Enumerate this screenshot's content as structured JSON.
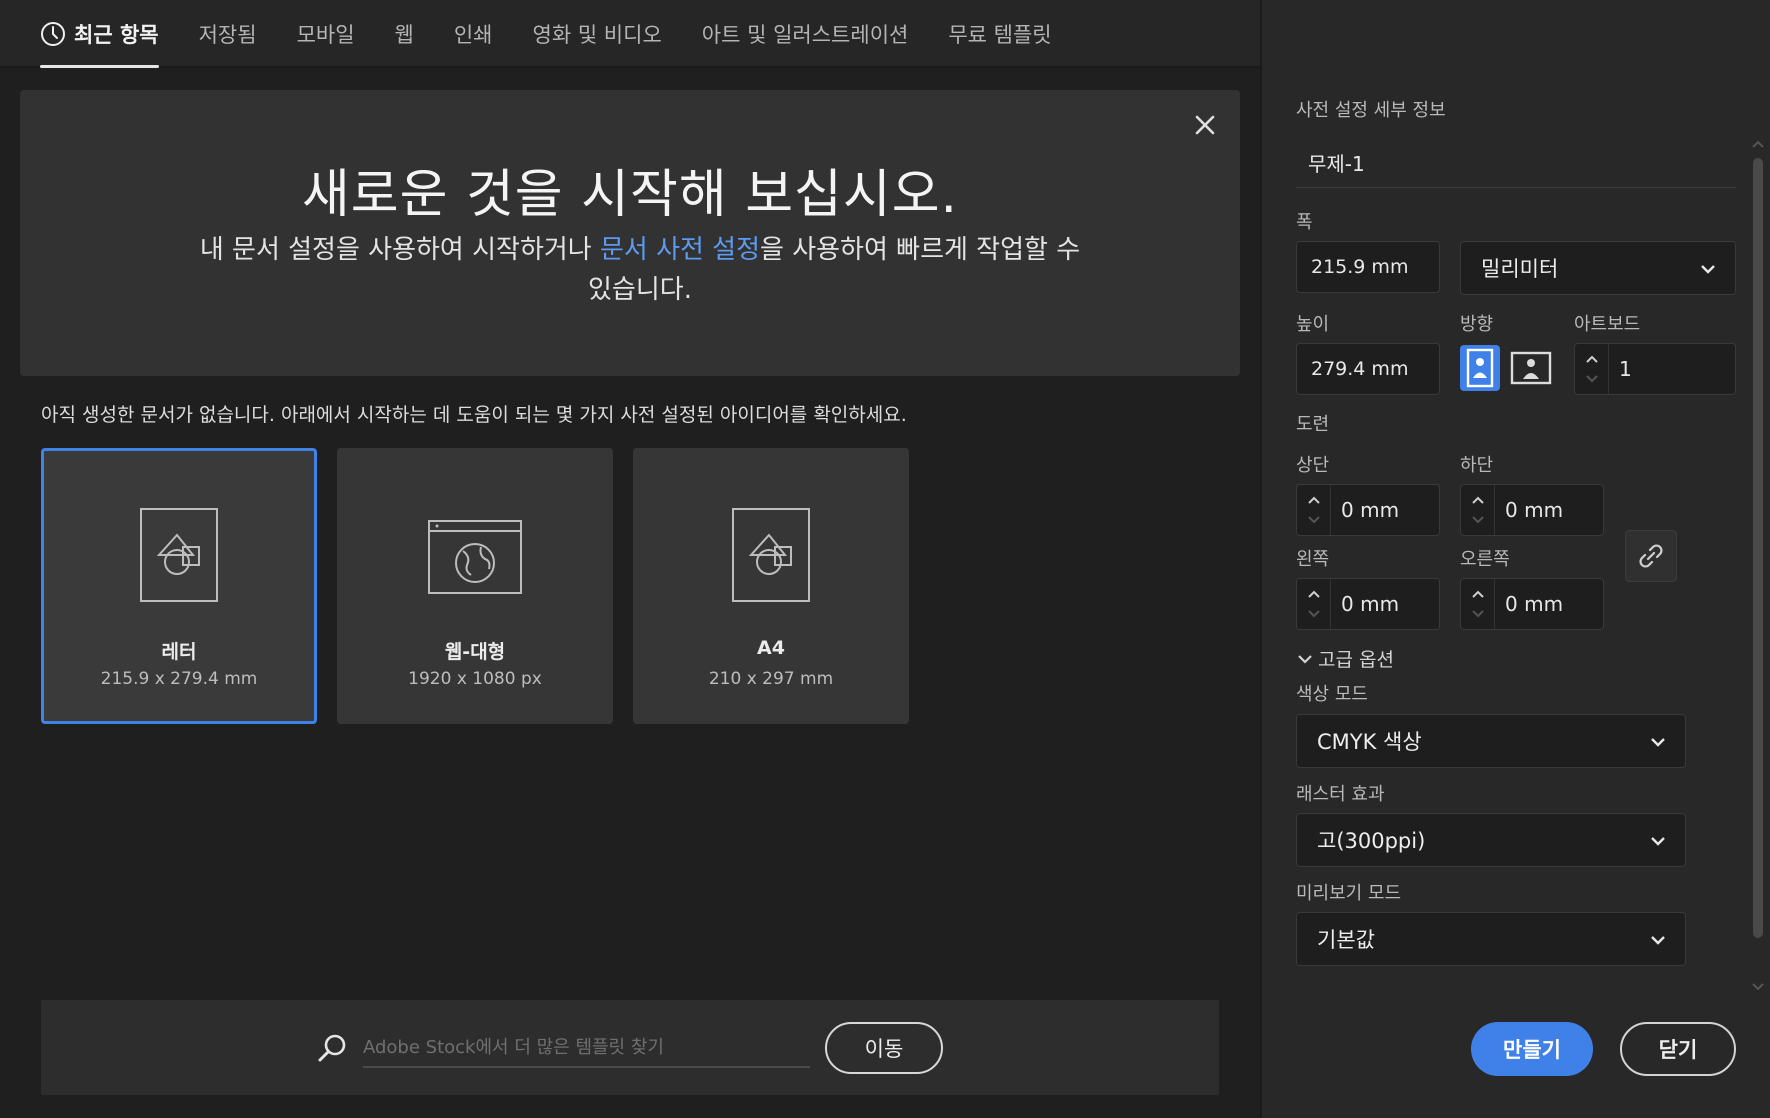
{
  "tabs": [
    {
      "label": "최근 항목",
      "active": true
    },
    {
      "label": "저장됨"
    },
    {
      "label": "모바일"
    },
    {
      "label": "웹"
    },
    {
      "label": "인쇄"
    },
    {
      "label": "영화 및 비디오"
    },
    {
      "label": "아트 및 일러스트레이션"
    },
    {
      "label": "무료 템플릿"
    }
  ],
  "hero": {
    "title": "새로운 것을 시작해 보십시오.",
    "desc_before": "내 문서 설정을 사용하여 시작하거나 ",
    "desc_link": "문서 사전 설정",
    "desc_after": "을 사용하여 빠르게 작업할 수 있습니다."
  },
  "no_docs_message": "아직 생성한 문서가 없습니다. 아래에서 시작하는 데 도움이 되는 몇 가지 사전 설정된 아이디어를 확인하세요.",
  "presets": [
    {
      "name": "레터",
      "size": "215.9 x 279.4 mm",
      "icon": "document-shapes-icon",
      "selected": true
    },
    {
      "name": "웹-대형",
      "size": "1920 x 1080 px",
      "icon": "web-globe-icon"
    },
    {
      "name": "A4",
      "size": "210 x 297 mm",
      "icon": "document-shapes-icon"
    }
  ],
  "stock": {
    "placeholder": "Adobe Stock에서 더 많은 템플릿 찾기",
    "go_label": "이동"
  },
  "details": {
    "section_title": "사전 설정 세부 정보",
    "doc_name": "무제-1",
    "width_label": "폭",
    "width_value": "215.9 mm",
    "unit_value": "밀리미터",
    "height_label": "높이",
    "height_value": "279.4 mm",
    "orientation_label": "방향",
    "orientation": "portrait",
    "artboard_label": "아트보드",
    "artboard_value": "1",
    "bleed_label": "도련",
    "top_label": "상단",
    "top_value": "0 mm",
    "bottom_label": "하단",
    "bottom_value": "0 mm",
    "left_label": "왼쪽",
    "left_value": "0 mm",
    "right_label": "오른쪽",
    "right_value": "0 mm",
    "advanced_label": "고급 옵션",
    "color_mode_label": "색상 모드",
    "color_mode_value": "CMYK 색상",
    "raster_label": "래스터 효과",
    "raster_value": "고(300ppi)",
    "preview_label": "미리보기 모드",
    "preview_value": "기본값",
    "create_label": "만들기",
    "close_label": "닫기"
  },
  "colors": {
    "accent": "#3f81e8",
    "link": "#5d9bf0",
    "background": "#1f1f1f",
    "panel": "#282828"
  }
}
